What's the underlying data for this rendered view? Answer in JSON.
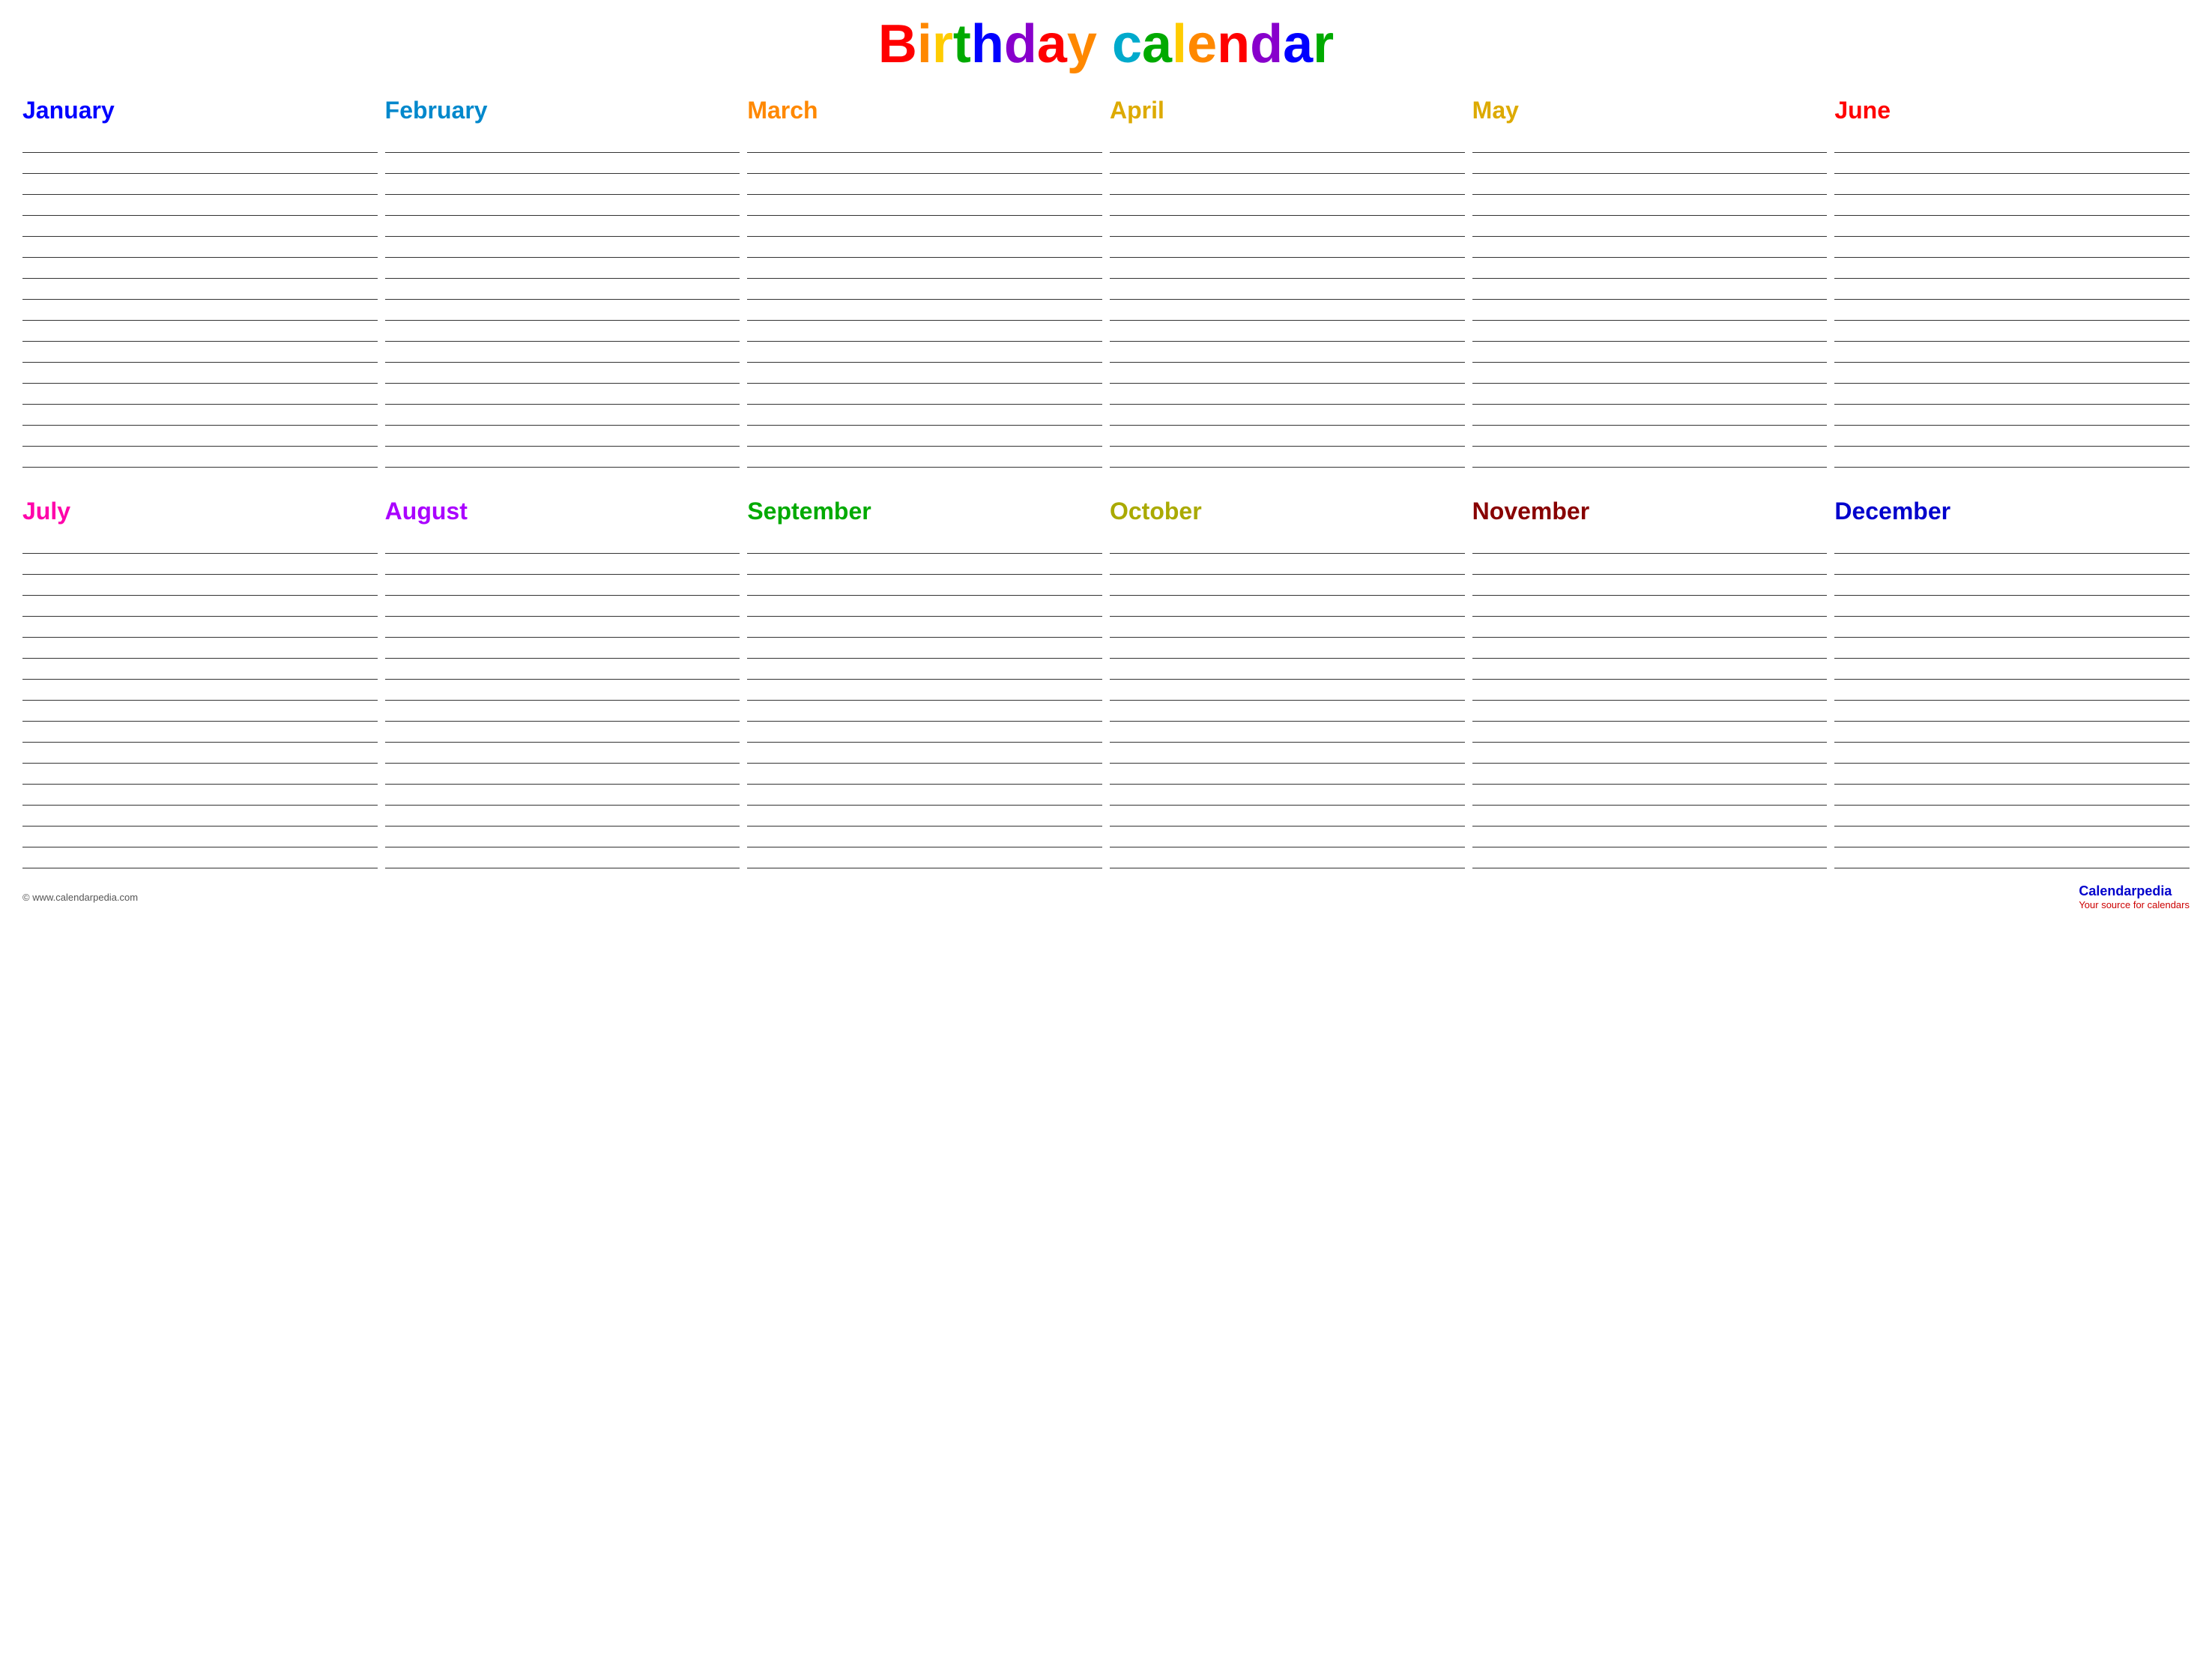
{
  "title": {
    "full": "Birthday calendar",
    "letters": [
      {
        "char": "B",
        "color": "#ff0000"
      },
      {
        "char": "i",
        "color": "#ff8800"
      },
      {
        "char": "r",
        "color": "#ffcc00"
      },
      {
        "char": "t",
        "color": "#00aa00"
      },
      {
        "char": "h",
        "color": "#0000ff"
      },
      {
        "char": "d",
        "color": "#8800cc"
      },
      {
        "char": "a",
        "color": "#ff0000"
      },
      {
        "char": "y",
        "color": "#ff8800"
      },
      {
        "char": " ",
        "color": "#000000"
      },
      {
        "char": "c",
        "color": "#00aacc"
      },
      {
        "char": "a",
        "color": "#00aa00"
      },
      {
        "char": "l",
        "color": "#ffcc00"
      },
      {
        "char": "e",
        "color": "#ff8800"
      },
      {
        "char": "n",
        "color": "#ff0000"
      },
      {
        "char": "d",
        "color": "#8800cc"
      },
      {
        "char": "a",
        "color": "#0000ff"
      },
      {
        "char": "r",
        "color": "#00aa00"
      }
    ]
  },
  "months_row1": [
    {
      "label": "January",
      "color": "#0000ff"
    },
    {
      "label": "February",
      "color": "#0088cc"
    },
    {
      "label": "March",
      "color": "#ff8800"
    },
    {
      "label": "April",
      "color": "#ffcc00"
    },
    {
      "label": "May",
      "color": "#ffcc00"
    },
    {
      "label": "June",
      "color": "#ff0000"
    }
  ],
  "months_row2": [
    {
      "label": "July",
      "color": "#ff00aa"
    },
    {
      "label": "August",
      "color": "#aa00ff"
    },
    {
      "label": "September",
      "color": "#00aa00"
    },
    {
      "label": "October",
      "color": "#aaaa00"
    },
    {
      "label": "November",
      "color": "#880000"
    },
    {
      "label": "December",
      "color": "#0000cc"
    }
  ],
  "lines_per_month": 16,
  "footer": {
    "left": "© www.calendarpedia.com",
    "brand": "Calendarpedia",
    "tagline": "Your source for calendars"
  }
}
